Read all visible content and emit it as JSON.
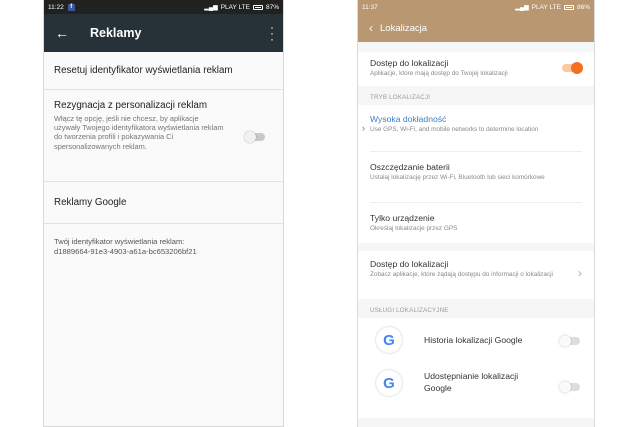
{
  "left": {
    "status": {
      "time": "11:22",
      "fb": "f",
      "network": "PLAY LTE",
      "battery": "87%"
    },
    "title": "Reklamy",
    "reset_label": "Resetuj identyfikator wyświetlania reklam",
    "optout": {
      "title": "Rezygnacja z personalizacji reklam",
      "description": "Włącz tę opcję, jeśli nie chcesz, by aplikacje używały Twojego identyfikatora wyświetlania reklam do tworzenia profili i pokazywania Ci spersonalizowanych reklam.",
      "enabled": false
    },
    "google_ads_label": "Reklamy Google",
    "ad_id": {
      "label": "Twój identyfikator wyświetlania reklam:",
      "value": "d1889664-91e3-4903-a61a-bc653206bf21"
    }
  },
  "right": {
    "status": {
      "time": "11:37",
      "network": "PLAY LTE",
      "battery": "86%"
    },
    "title": "Lokalizacja",
    "access": {
      "title": "Dostęp do lokalizacji",
      "subtitle": "Aplikacje, które mają dostęp do Twojej lokalizacji",
      "enabled": true
    },
    "mode_header": "TRYB LOKALIZACJI",
    "modes": [
      {
        "title": "Wysoka dokładność",
        "subtitle": "Use GPS, Wi-Fi, and mobile networks to determine location",
        "selected": true
      },
      {
        "title": "Oszczędzanie baterii",
        "subtitle": "Ustalaj lokalizację przez Wi-Fi, Bluetooth lub sieci komórkowe",
        "selected": false
      },
      {
        "title": "Tylko urządzenie",
        "subtitle": "Określaj lokalizacje przez GPS",
        "selected": false
      }
    ],
    "app_access": {
      "title": "Dostęp do lokalizacji",
      "subtitle": "Zobacz aplikacje, które żądają dostępu do informacji o lokalizacji"
    },
    "services_header": "USŁUGI LOKALIZACYJNE",
    "services": [
      {
        "label": "Historia lokalizacji Google",
        "enabled": false
      },
      {
        "label": "Udostępnianie lokalizacji Google",
        "enabled": false
      }
    ],
    "accent_color": "#3d7fc9",
    "toggle_on_color": "#f37021",
    "header_color": "#b89771"
  },
  "icons": {
    "google_logo": "G",
    "back": "←",
    "menu": "⋮",
    "chevron": "›"
  }
}
